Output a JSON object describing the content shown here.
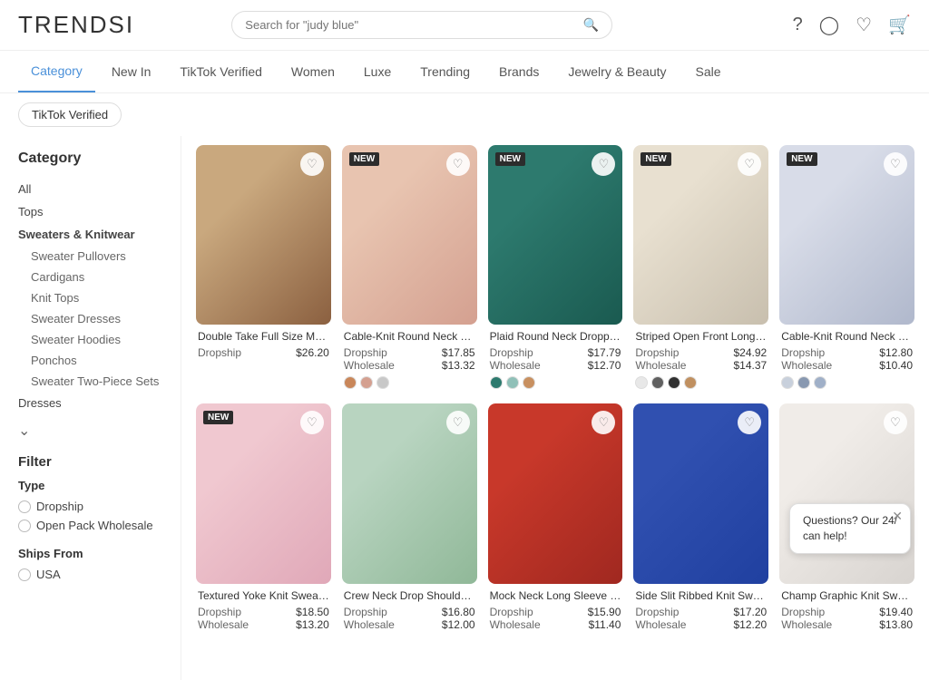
{
  "header": {
    "logo": "TRENDSI",
    "search_placeholder": "Search for \"judy blue\"",
    "icons": [
      "help-icon",
      "user-icon",
      "wishlist-icon",
      "cart-icon"
    ]
  },
  "nav": {
    "items": [
      {
        "label": "Category",
        "active": true
      },
      {
        "label": "New In",
        "active": false
      },
      {
        "label": "TikTok Verified",
        "active": false
      },
      {
        "label": "Women",
        "active": false
      },
      {
        "label": "Luxe",
        "active": false
      },
      {
        "label": "Trending",
        "active": false
      },
      {
        "label": "Brands",
        "active": false
      },
      {
        "label": "Jewelry & Beauty",
        "active": false
      },
      {
        "label": "Sale",
        "active": false
      }
    ]
  },
  "filter_chip": "TikTok Verified",
  "sidebar": {
    "title": "Category",
    "items": [
      {
        "label": "All",
        "bold": false,
        "indent": false
      },
      {
        "label": "Tops",
        "bold": false,
        "indent": false
      },
      {
        "label": "Sweaters & Knitwear",
        "bold": true,
        "indent": false
      },
      {
        "label": "Sweater Pullovers",
        "bold": false,
        "indent": true
      },
      {
        "label": "Cardigans",
        "bold": false,
        "indent": true
      },
      {
        "label": "Knit Tops",
        "bold": false,
        "indent": true
      },
      {
        "label": "Sweater Dresses",
        "bold": false,
        "indent": true
      },
      {
        "label": "Sweater Hoodies",
        "bold": false,
        "indent": true
      },
      {
        "label": "Ponchos",
        "bold": false,
        "indent": true
      },
      {
        "label": "Sweater Two-Piece Sets",
        "bold": false,
        "indent": true
      },
      {
        "label": "Dresses",
        "bold": false,
        "indent": false
      }
    ]
  },
  "filter": {
    "title": "Filter",
    "type_title": "Type",
    "options": [
      "Dropship",
      "Open Pack Wholesale"
    ],
    "ships_from_title": "Ships From",
    "ships_options": [
      "USA"
    ]
  },
  "products": [
    {
      "name": "Double Take Full Size Multicolor...",
      "badge": "",
      "dropship_price": "$26.20",
      "wholesale_price": null,
      "img_class": "img-p1",
      "swatches": []
    },
    {
      "name": "Cable-Knit Round Neck Top and...",
      "badge": "NEW",
      "dropship_price": "$17.85",
      "wholesale_price": "$13.32",
      "img_class": "img-p2",
      "swatches": [
        "#c9875a",
        "#d4a090",
        "#c8c8c8"
      ]
    },
    {
      "name": "Plaid Round Neck Dropped Sho...",
      "badge": "NEW",
      "dropship_price": "$17.79",
      "wholesale_price": "$12.70",
      "img_class": "img-p3",
      "swatches": [
        "#2d7a6e",
        "#90c0b8",
        "#c89060"
      ]
    },
    {
      "name": "Striped Open Front Long Sleeve...",
      "badge": "NEW",
      "dropship_price": "$24.92",
      "wholesale_price": "$14.37",
      "img_class": "img-p4",
      "swatches": [
        "#e8e8e8",
        "#606060",
        "#303030",
        "#c09060"
      ]
    },
    {
      "name": "Cable-Knit Round Neck Sweater",
      "badge": "NEW",
      "dropship_price": "$12.80",
      "wholesale_price": "$10.40",
      "img_class": "img-p5",
      "swatches": [
        "#c8d0dc",
        "#8898b0",
        "#a0b0c8"
      ]
    },
    {
      "name": "Textured Yoke Knit Sweater",
      "badge": "NEW",
      "dropship_price": "$18.50",
      "wholesale_price": "$13.20",
      "img_class": "img-p6",
      "swatches": []
    },
    {
      "name": "Crew Neck Drop Shoulder Sweater",
      "badge": "",
      "dropship_price": "$16.80",
      "wholesale_price": "$12.00",
      "img_class": "img-p7",
      "swatches": []
    },
    {
      "name": "Mock Neck Long Sleeve Knit Top",
      "badge": "",
      "dropship_price": "$15.90",
      "wholesale_price": "$11.40",
      "img_class": "img-p8",
      "swatches": []
    },
    {
      "name": "Side Slit Ribbed Knit Sweater",
      "badge": "",
      "dropship_price": "$17.20",
      "wholesale_price": "$12.20",
      "img_class": "img-p9",
      "swatches": []
    },
    {
      "name": "Champ Graphic Knit Sweater",
      "badge": "",
      "dropship_price": "$19.40",
      "wholesale_price": "$13.80",
      "img_class": "img-p10",
      "swatches": []
    }
  ],
  "labels": {
    "dropship": "Dropship",
    "wholesale": "Wholesale",
    "chat_text": "Questions? Our 24/ can help!"
  }
}
